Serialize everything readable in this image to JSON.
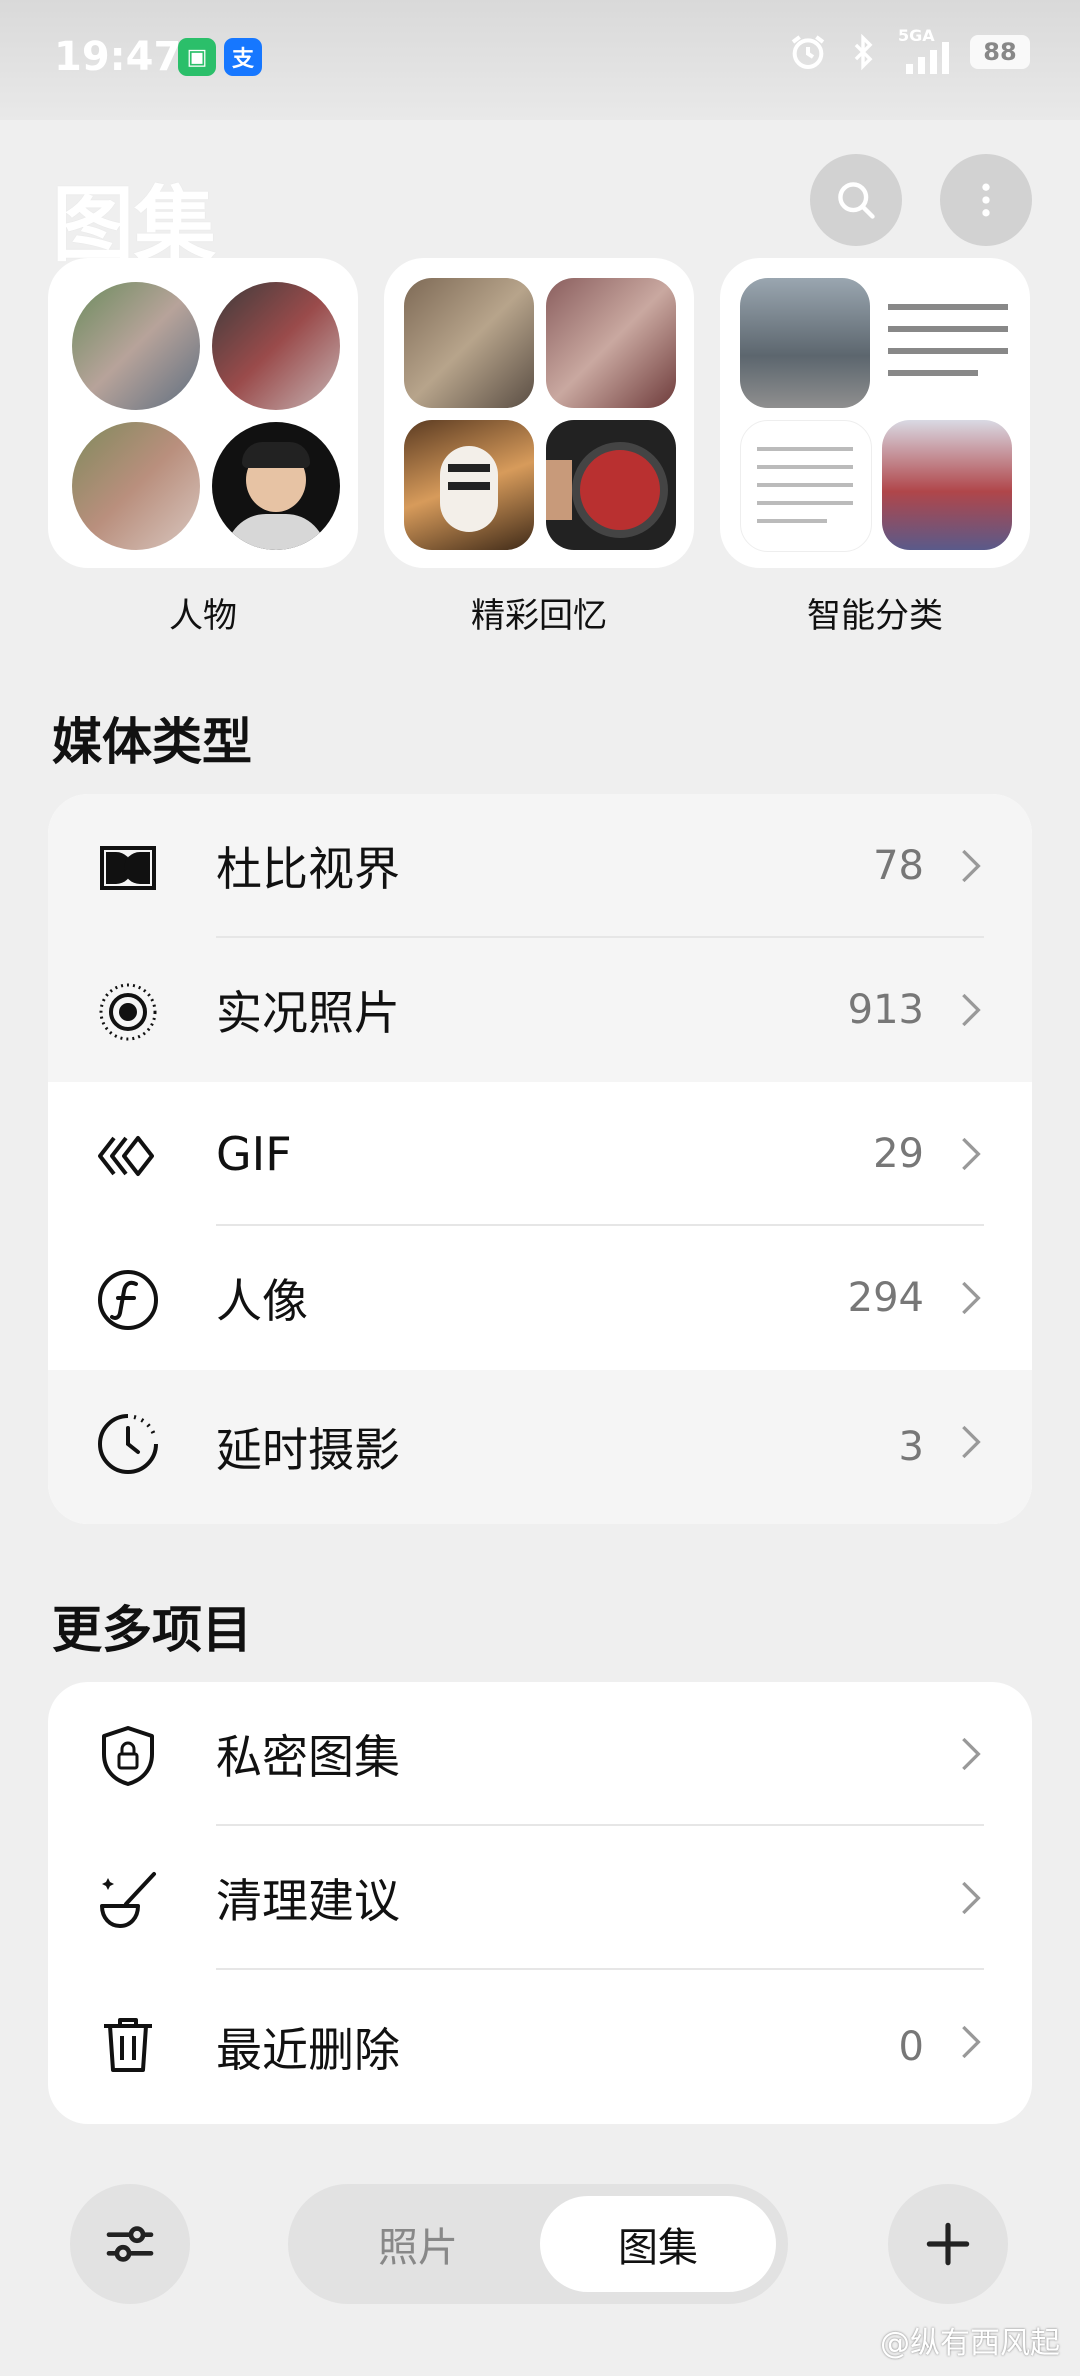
{
  "status_bar": {
    "time": "19:47",
    "battery": "88",
    "network": "5GA",
    "apps": [
      {
        "icon": "mi-home-icon",
        "color": "#2bbf6a",
        "glyph": "◘"
      },
      {
        "icon": "alipay-icon",
        "color": "#1677ff",
        "glyph": "支"
      }
    ]
  },
  "header": {
    "title": "图集"
  },
  "albums": [
    {
      "label": "人物"
    },
    {
      "label": "精彩回忆"
    },
    {
      "label": "智能分类"
    }
  ],
  "media_types": {
    "title": "媒体类型",
    "items": [
      {
        "label": "杜比视界",
        "count": "78",
        "icon": "dolby-vision-icon"
      },
      {
        "label": "实况照片",
        "count": "913",
        "icon": "live-photo-icon"
      },
      {
        "label": "GIF",
        "count": "29",
        "icon": "gif-icon"
      },
      {
        "label": "人像",
        "count": "294",
        "icon": "portrait-icon"
      },
      {
        "label": "延时摄影",
        "count": "3",
        "icon": "timelapse-icon"
      }
    ]
  },
  "more_items": {
    "title": "更多项目",
    "items": [
      {
        "label": "私密图集",
        "count": "",
        "icon": "private-album-icon"
      },
      {
        "label": "清理建议",
        "count": "",
        "icon": "cleanup-icon"
      },
      {
        "label": "最近删除",
        "count": "0",
        "icon": "trash-icon"
      }
    ]
  },
  "bottom_nav": {
    "tabs": [
      {
        "label": "照片",
        "active": false
      },
      {
        "label": "图集",
        "active": true
      }
    ]
  },
  "watermark": "@纵有西风起"
}
